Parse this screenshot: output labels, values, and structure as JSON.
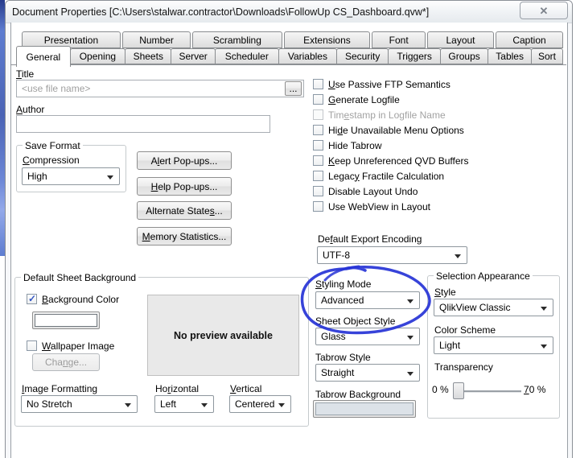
{
  "window": {
    "title": "Document Properties [C:\\Users\\stalwar.contractor\\Downloads\\FollowUp CS_Dashboard.qvw*]",
    "close_icon": "✕"
  },
  "tabs": {
    "row1": [
      "Presentation",
      "Number",
      "Scrambling",
      "Extensions",
      "Font",
      "Layout",
      "Caption"
    ],
    "row2": [
      "General",
      "Opening",
      "Sheets",
      "Server",
      "Scheduler",
      "Variables",
      "Security",
      "Triggers",
      "Groups",
      "Tables",
      "Sort"
    ],
    "selected": "General"
  },
  "title_field": {
    "label": "&Title",
    "placeholder": "<use file name>",
    "browse_label": "..."
  },
  "author_field": {
    "label": "&Author",
    "value": ""
  },
  "save_format": {
    "group_label": "Save Format",
    "compression_label": "&Compression",
    "compression_value": "High"
  },
  "action_buttons": {
    "alert": "A&lert Pop-ups...",
    "help": "&Help Pop-ups...",
    "alternate_states": "Alternate State&s...",
    "memory_statistics": "&Memory Statistics..."
  },
  "options": [
    {
      "label": "&Use Passive FTP Semantics",
      "checked": false,
      "disabled": false
    },
    {
      "label": "&Generate Logfile",
      "checked": false,
      "disabled": false
    },
    {
      "label": "Tim&estamp in Logfile Name",
      "checked": false,
      "disabled": true
    },
    {
      "label": "Hi&de Unavailable Menu Options",
      "checked": false,
      "disabled": false
    },
    {
      "label": "Hide Tabrow",
      "checked": false,
      "disabled": false
    },
    {
      "label": "&Keep Unreferenced QVD Buffers",
      "checked": false,
      "disabled": false
    },
    {
      "label": "Legac&y Fractile Calculation",
      "checked": false,
      "disabled": false
    },
    {
      "label": "Disable Layout Undo",
      "checked": false,
      "disabled": false
    },
    {
      "label": "Use WebView in Layout",
      "checked": false,
      "disabled": false
    }
  ],
  "export_encoding": {
    "label": "De&fault Export Encoding",
    "value": "UTF-8"
  },
  "sheet_background": {
    "group_label": "Default Sheet Background",
    "background_color_label": "&Background Color",
    "background_color_checked": true,
    "wallpaper_image_label": "&Wallpaper Image",
    "wallpaper_image_checked": false,
    "change_button": "Cha&nge...",
    "preview_text": "No preview available",
    "image_formatting_label": "&Image Formatting",
    "image_formatting_value": "No Stretch",
    "horizontal_label": "Ho&rizontal",
    "horizontal_value": "Left",
    "vertical_label": "&Vertical",
    "vertical_value": "Centered"
  },
  "styling": {
    "styling_mode_label": "&Styling Mode",
    "styling_mode_value": "Advanced",
    "sheet_object_style_label": "Sheet Ob&ject Style",
    "sheet_object_style_value": "Glass",
    "tabrow_style_label": "Tabrow Style",
    "tabrow_style_value": "Straight",
    "tabrow_background_label": "Tabrow Background"
  },
  "selection_appearance": {
    "group_label": "Selection Appearance",
    "style_label": "&Style",
    "style_value": "QlikView Classic",
    "color_scheme_label": "Color Scheme",
    "color_scheme_value": "Light",
    "transparency_label": "Transparency",
    "transparency_min": "0 %",
    "transparency_max": "&70 %"
  },
  "annotation": {
    "shape": "hand-drawn-ellipse",
    "color": "#2633d6"
  },
  "colors": {
    "check_blue": "#3457c4",
    "tabrow_swatch_fill": "#dce2e8",
    "annotation_blue": "#2633d6"
  }
}
